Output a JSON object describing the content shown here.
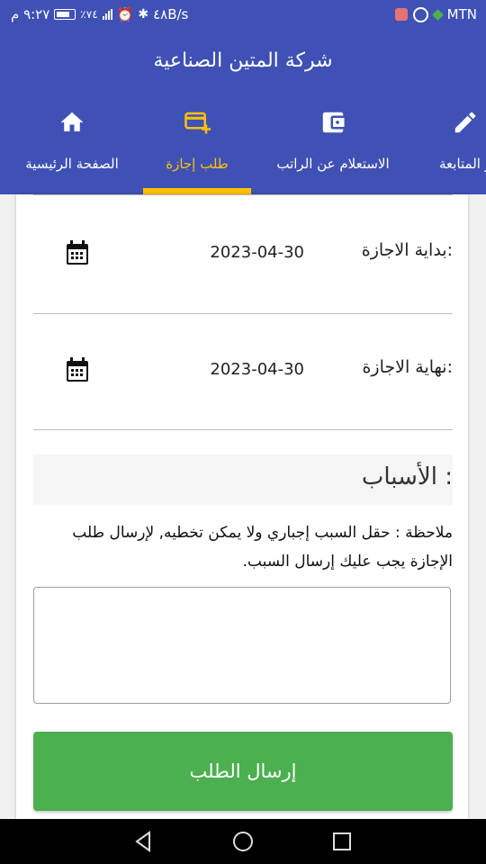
{
  "status_bar": {
    "carrier": "MTN",
    "time": "٩:٢٧ م",
    "battery": "٪٧٤",
    "net_speed": "٤٨B/s",
    "icons": [
      "sim-icon",
      "whatsapp-icon",
      "diamond-icon",
      "signal-icon",
      "battery-icon",
      "alarm-icon",
      "bluetooth-icon"
    ]
  },
  "app": {
    "title": "شركة المتين الصناعية"
  },
  "tabs": [
    {
      "label": "الصفحة الرئيسية",
      "icon": "home-icon"
    },
    {
      "label": "طلب إجازة",
      "icon": "card-add-icon",
      "active": true
    },
    {
      "label": "الاستعلام عن الراتب",
      "icon": "wallet-icon"
    },
    {
      "label": "و المتابعة",
      "icon": "edit-icon"
    }
  ],
  "form": {
    "start": {
      "label": "بداية الاجازة:",
      "value": "2023-04-30",
      "icon": "calendar-icon"
    },
    "end": {
      "label": "نهاية الاجازة:",
      "value": "2023-04-30",
      "icon": "calendar-icon"
    },
    "reasons_heading": "الأسباب :",
    "note": "ملاحظة : حقل السبب إجباري ولا يمكن تخطيه, لإرسال طلب الإجازة يجب عليك إرسال السبب.",
    "reason_value": "",
    "submit_label": "إرسال الطلب"
  },
  "colors": {
    "primary": "#3f51b5",
    "accent": "#ffc107",
    "submit": "#4caf50"
  },
  "nav": [
    "back-icon",
    "home-circle-icon",
    "recents-icon"
  ]
}
